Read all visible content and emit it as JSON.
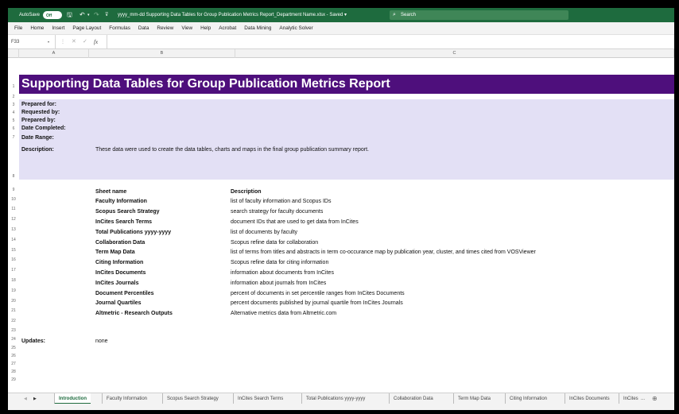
{
  "titlebar": {
    "autosave_label": "AutoSave",
    "autosave_state": "Off",
    "doc_title": "yyyy_mm-dd Supporting Data Tables for Group Publication Metrics Report_Department Name.xlsx  -  Saved  ▾",
    "search_placeholder": "Search",
    "icons": [
      "save-icon",
      "undo-icon",
      "redo-icon",
      "customize-icon",
      "search-icon"
    ]
  },
  "menu": [
    "File",
    "Home",
    "Insert",
    "Page Layout",
    "Formulas",
    "Data",
    "Review",
    "View",
    "Help",
    "Acrobat",
    "Data Mining",
    "Analytic Solver"
  ],
  "formula_bar": {
    "name_box": "F33",
    "value": ""
  },
  "columns": [
    "A",
    "B",
    "C"
  ],
  "row_numbers": [
    "1",
    "2",
    "3",
    "4",
    "5",
    "6",
    "7",
    "8",
    "9",
    "10",
    "11",
    "12",
    "13",
    "14",
    "15",
    "16",
    "17",
    "18",
    "19",
    "20",
    "21",
    "22",
    "23",
    "24",
    "25",
    "26",
    "27",
    "28",
    "29"
  ],
  "sheet": {
    "title": "Supporting Data Tables for Group Publication Metrics Report",
    "info_labels": [
      "Prepared for:",
      "Requested by:",
      "Prepared by:",
      "Date Completed:",
      "Date Range:"
    ],
    "description_label": "Description:",
    "description_text": "These data were used to create the data tables, charts and maps in the final group publication summary report.",
    "table_header": {
      "name": "Sheet name",
      "desc": "Description"
    },
    "table_rows": [
      {
        "name": "Faculty Information",
        "desc": "list of faculty information and Scopus IDs"
      },
      {
        "name": "Scopus Search Strategy",
        "desc": "search strategy for faculty documents"
      },
      {
        "name": "InCites Search Terms",
        "desc": "document IDs that are used to get data from InCites"
      },
      {
        "name": "Total Publications yyyy-yyyy",
        "desc": "list of documents by faculty"
      },
      {
        "name": "Collaboration Data",
        "desc": "Scopus refine data for collaboration"
      },
      {
        "name": "Term Map Data",
        "desc": "list of terms from titles and abstracts in term co-occurance map by publication year, cluster, and times cited from VOSViewer"
      },
      {
        "name": "Citing Information",
        "desc": "Scopus refine data for citing information"
      },
      {
        "name": "InCites Documents",
        "desc": "information about documents from InCites"
      },
      {
        "name": "InCites Journals",
        "desc": "information about journals from InCites"
      },
      {
        "name": "Document Percentiles",
        "desc": "percent of documents in set percentile ranges from InCites Documents"
      },
      {
        "name": "Journal Quartiles",
        "desc": "percent documents published by journal quartile from InCites Journals"
      },
      {
        "name": "Altmetric - Research Outputs",
        "desc": "Alternative metrics data from Altmetric.com"
      }
    ],
    "updates_label": "Updates:",
    "updates_value": "none"
  },
  "tabs": [
    "Introduction",
    "Faculty Information",
    "Scopus Search Strategy",
    "InCites Search Terms",
    "Total Publications yyyy-yyyy",
    "Collaboration Data",
    "Term Map Data",
    "Citing Information",
    "InCites Documents",
    "InCites"
  ],
  "tab_more": "...",
  "colors": {
    "title_bar": "#1e6b3e",
    "header_fill": "#4e0f7c",
    "info_fill": "#e3e0f5"
  }
}
